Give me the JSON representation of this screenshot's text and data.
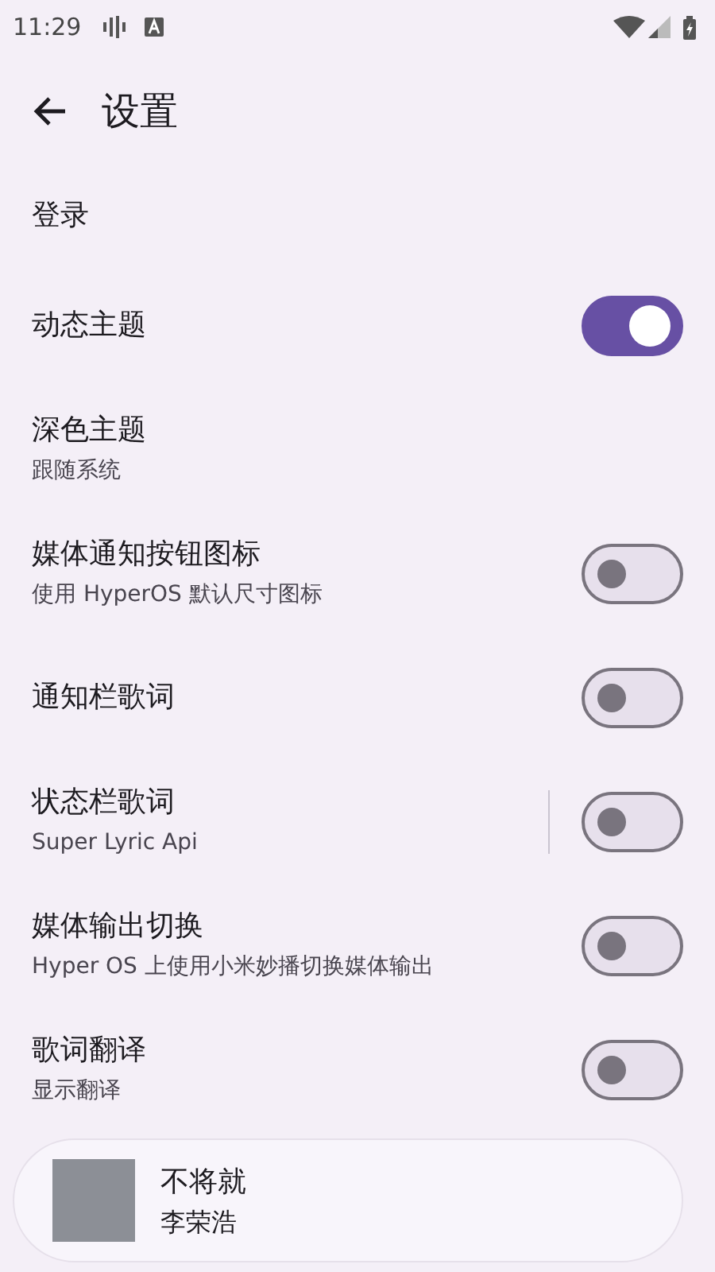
{
  "status_bar": {
    "time": "11:29"
  },
  "header": {
    "title": "设置"
  },
  "settings": [
    {
      "kind": "plain",
      "title": "登录"
    },
    {
      "kind": "switch",
      "title": "动态主题",
      "on": true
    },
    {
      "kind": "plain",
      "title": "深色主题",
      "subtitle": "跟随系统"
    },
    {
      "kind": "switch",
      "title": "媒体通知按钮图标",
      "subtitle": "使用 HyperOS 默认尺寸图标",
      "on": false
    },
    {
      "kind": "switch",
      "title": "通知栏歌词",
      "on": false
    },
    {
      "kind": "switch",
      "title": "状态栏歌词",
      "subtitle": "Super Lyric Api",
      "on": false,
      "split": true
    },
    {
      "kind": "switch",
      "title": "媒体输出切换",
      "subtitle": "Hyper OS 上使用小米妙播切换媒体输出",
      "on": false
    },
    {
      "kind": "switch",
      "title": "歌词翻译",
      "subtitle": "显示翻译",
      "on": false
    }
  ],
  "player": {
    "title": "不将就",
    "artist": "李荣浩"
  }
}
